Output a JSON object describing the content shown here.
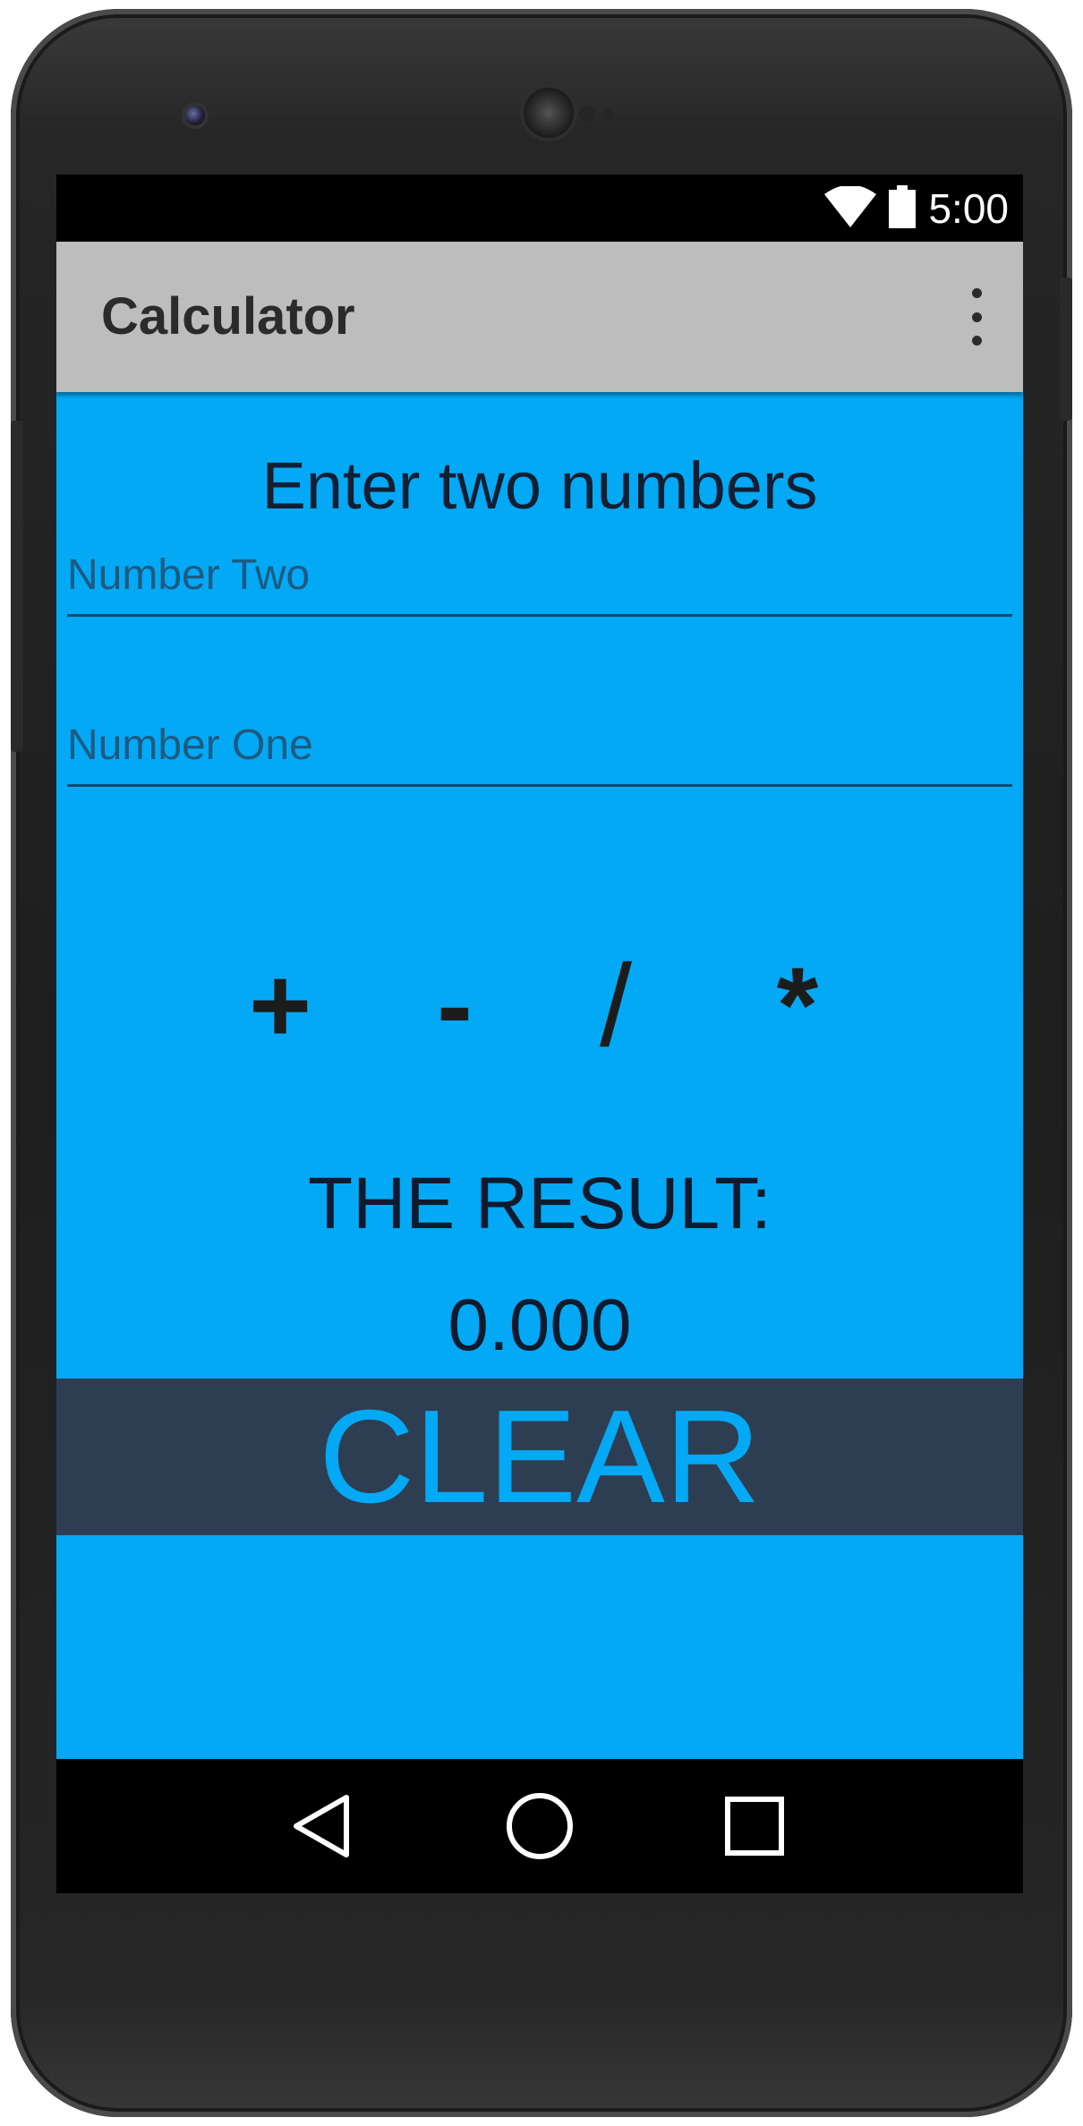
{
  "status_bar": {
    "time": "5:00",
    "icons": [
      "wifi-icon",
      "battery-icon"
    ]
  },
  "app_bar": {
    "title": "Calculator",
    "menu_icon": "overflow-menu-icon"
  },
  "main": {
    "heading": "Enter two numbers",
    "number_two": {
      "placeholder": "Number Two",
      "value": ""
    },
    "number_one": {
      "placeholder": "Number One",
      "value": ""
    },
    "operators": {
      "plus": "+",
      "minus": "-",
      "divide": "/",
      "multiply": "*"
    },
    "result_label": "THE RESULT:",
    "result_value": "0.000",
    "clear_label": "CLEAR"
  },
  "nav_bar": {
    "icons": [
      "back-icon",
      "home-icon",
      "recents-icon"
    ]
  },
  "colors": {
    "content_background": "#03a9f4",
    "app_bar": "#bdbdbd",
    "clear_button_background": "#2e3e52",
    "clear_button_text": "#03a9f4"
  }
}
